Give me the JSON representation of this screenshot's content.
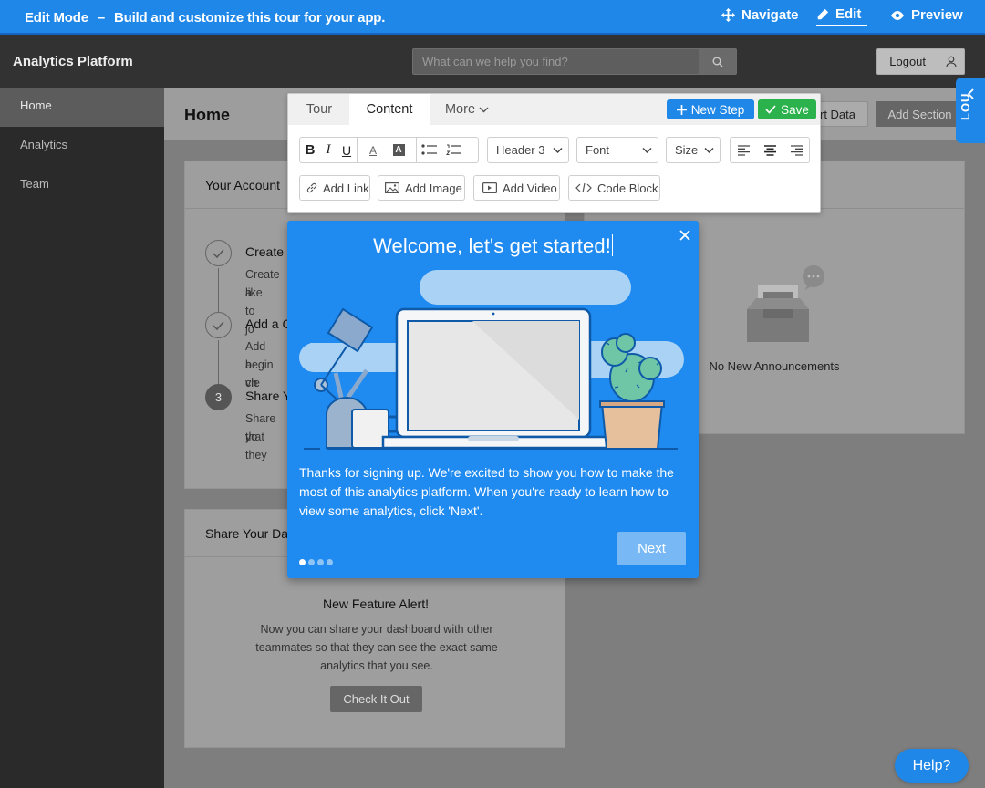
{
  "colors": {
    "accent": "#1f87e8",
    "save": "#2bb24c",
    "tour_bg": "#1f8af0"
  },
  "topbar": {
    "mode": "Edit Mode",
    "separator": "–",
    "description": "Build and customize this tour for your app.",
    "navigate": "Navigate",
    "edit": "Edit",
    "preview": "Preview"
  },
  "app": {
    "brand": "Analytics Platform",
    "search_placeholder": "What can we help you find?",
    "logout": "Logout"
  },
  "sidebar": {
    "items": [
      {
        "label": "Home",
        "active": true
      },
      {
        "label": "Analytics"
      },
      {
        "label": "Team"
      }
    ]
  },
  "header": {
    "title": "Home",
    "export_label": "rt Data",
    "add_section": "Add Section"
  },
  "account_card": {
    "title": "Your Account",
    "steps": [
      {
        "title": "Create a",
        "desc1": "Create a",
        "desc2": "like to jo"
      },
      {
        "title": "Add a C",
        "desc1": "Add a ch",
        "desc2": "begin vie"
      },
      {
        "number": "3",
        "title": "Share Y",
        "desc1": "Share yo",
        "desc2": "that they"
      }
    ]
  },
  "share_card": {
    "title": "Share Your Da",
    "feature_title": "New Feature Alert!",
    "feature_desc": "Now you can share your dashboard with other teammates so that they can see the exact same analytics that you see.",
    "button": "Check It Out"
  },
  "announce": {
    "empty": "No New Announcements"
  },
  "editor": {
    "tabs": [
      "Tour",
      "Content",
      "More"
    ],
    "new_step": "New Step",
    "save": "Save",
    "bold": "B",
    "italic": "I",
    "underline": "U",
    "font_color": "A",
    "bg_color": "A",
    "header_select": "Header 3",
    "font_select": "Font",
    "size_select": "Size",
    "add_link": "Add Link",
    "add_image": "Add Image",
    "add_video": "Add Video",
    "code_block": "Code Block"
  },
  "tour": {
    "title": "Welcome, let's get started!",
    "body": "Thanks for signing up. We're excited to show you how to make the most of this analytics platform. When you're ready to learn how to view some analytics, click 'Next'.",
    "next": "Next",
    "steps_total": 4,
    "current_step": 1
  },
  "lou": {
    "label": "LOU"
  },
  "help": {
    "label": "Help?"
  }
}
